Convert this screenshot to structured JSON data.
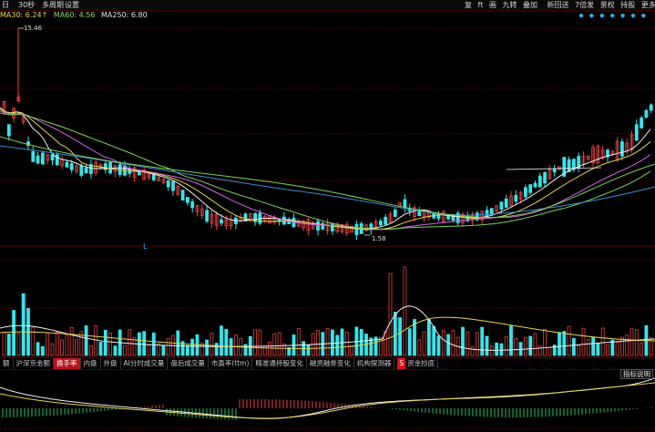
{
  "toolbar": {
    "period": "日",
    "period2": "30秒",
    "multi": "多周期",
    "settings": "设置",
    "right_tools": [
      "复",
      "ft",
      "画",
      "九转",
      "叠加",
      "",
      "新回送",
      "7倍发",
      "景权",
      "",
      "持股",
      "",
      "更多"
    ]
  },
  "ma_legend": [
    {
      "label": "MA30: 6.24↑",
      "color": "#e7d44c"
    },
    {
      "label": "MA60: 4.56",
      "color": "#8fd46a"
    },
    {
      "label": "MA250: 6.80",
      "color": "#e0e0e0"
    }
  ],
  "price_labels": {
    "high": "15.46",
    "low": "1.58"
  },
  "tabs": [
    {
      "label": "额",
      "active": false
    },
    {
      "label": "沪深京金额",
      "active": false
    },
    {
      "label": "换手率",
      "active": true
    },
    {
      "label": "内盘",
      "active": false
    },
    {
      "label": "外盘",
      "active": false
    },
    {
      "label": "AI分时成交量",
      "active": false
    },
    {
      "label": "盘后成交量",
      "active": false
    },
    {
      "label": "市盈率(ttm)",
      "active": false
    },
    {
      "label": "精准通持股变化",
      "active": false
    },
    {
      "label": "融资融券变化",
      "active": false
    },
    {
      "label": "机构探测器",
      "active": false
    },
    {
      "label": "资金抄底",
      "active": false,
      "vip": "S"
    }
  ],
  "indicator_button": "指标说明",
  "left_marker": "L",
  "colors": {
    "up": "#e8413d",
    "down": "#2ee8ee",
    "grid": "#5a0000",
    "ma_white": "#f0f0f0",
    "ma_yellow": "#e7d44c",
    "ma_purple": "#d063e8",
    "ma_green": "#7ad454",
    "ma_blue": "#3a8ed6"
  }
}
